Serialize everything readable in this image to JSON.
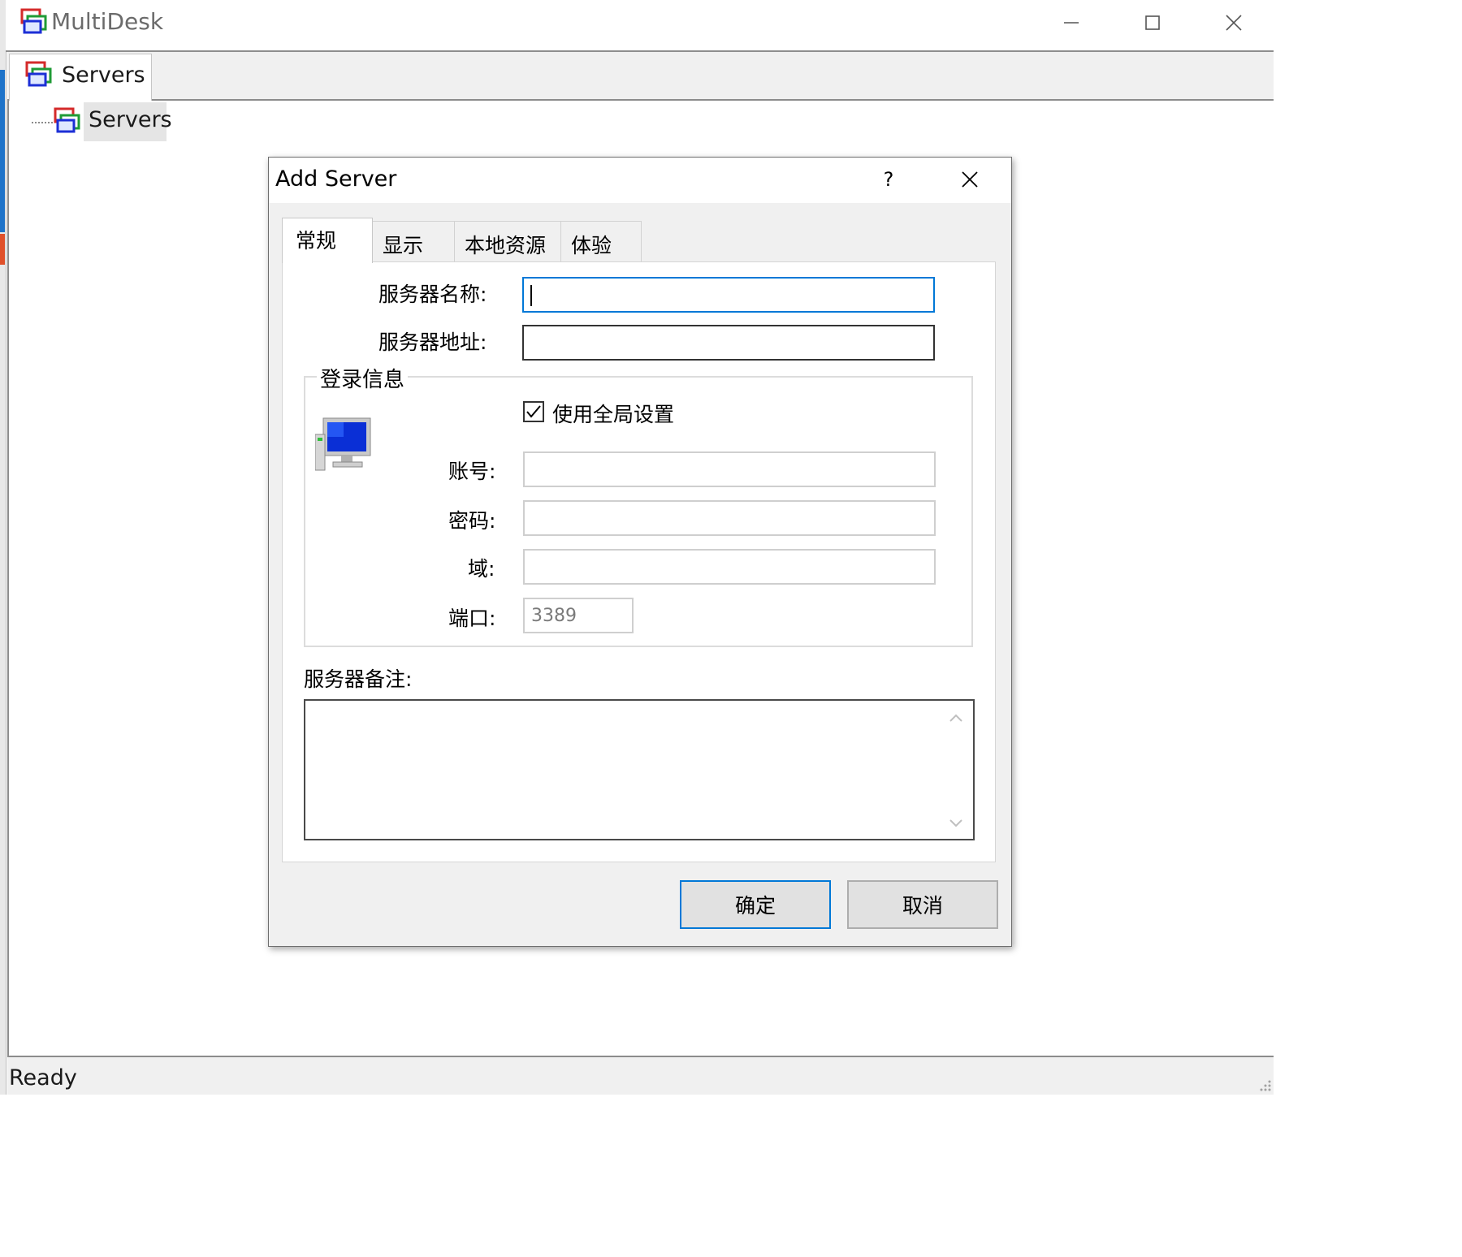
{
  "window": {
    "title": "MultiDesk",
    "icon": "multidesk-app-icon"
  },
  "tabs": [
    {
      "label": "Servers",
      "active": true
    }
  ],
  "tree": {
    "root_label": "Servers"
  },
  "status": {
    "text": "Ready"
  },
  "dialog": {
    "title": "Add Server",
    "help_label": "?",
    "tabs": [
      {
        "label": "常规",
        "active": true
      },
      {
        "label": "显示",
        "active": false
      },
      {
        "label": "本地资源",
        "active": false
      },
      {
        "label": "体验",
        "active": false
      }
    ],
    "server_name_label": "服务器名称:",
    "server_name_value": "",
    "server_address_label": "服务器地址:",
    "server_address_value": "",
    "login_group_title": "登录信息",
    "use_global_label": "使用全局设置",
    "use_global_checked": true,
    "account_label": "账号:",
    "account_value": "",
    "password_label": "密码:",
    "password_value": "",
    "domain_label": "域:",
    "domain_value": "",
    "port_label": "端口:",
    "port_value": "3389",
    "notes_label": "服务器备注:",
    "notes_value": "",
    "ok_label": "确定",
    "cancel_label": "取消"
  },
  "colors": {
    "focus_blue": "#0078d7",
    "chrome_gray": "#f0f0f0"
  }
}
